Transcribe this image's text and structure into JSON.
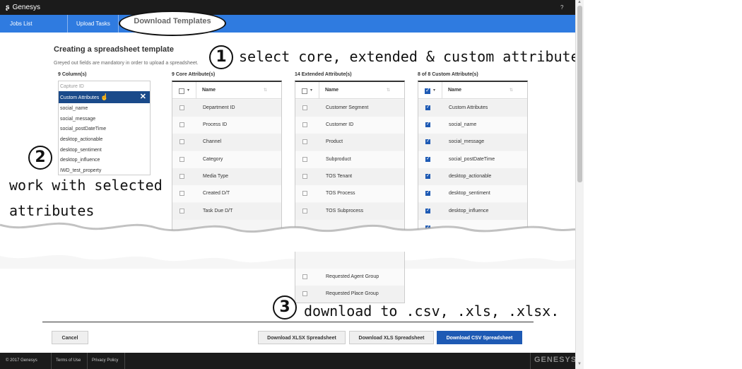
{
  "app": {
    "brand": "Genesys",
    "help": "?"
  },
  "tabs": {
    "jobs_list": "Jobs List",
    "upload_tasks": "Upload Tasks",
    "download_templates": "Download Templates"
  },
  "page": {
    "title": "Creating a spreadsheet template",
    "subtitle": "Greyed out fields are mandatory in order to upload a spreadsheet."
  },
  "callouts": {
    "one_num": "1",
    "one_text": "select core, extended & custom attributes",
    "two_num": "2",
    "two_line1": "work with selected",
    "two_line2": "attributes",
    "three_num": "3",
    "three_text": "download to .csv, .xls, .xlsx."
  },
  "columns": {
    "heading": "9 Column(s)",
    "items": [
      "Capture ID",
      "Custom Attributes",
      "social_name",
      "social_message",
      "social_postDateTime",
      "desktop_actionable",
      "desktop_sentiment",
      "desktop_influence",
      "IWD_test_property"
    ]
  },
  "core": {
    "heading": "9 Core Attribute(s)",
    "name_header": "Name",
    "rows": [
      "Department ID",
      "Process ID",
      "Channel",
      "Category",
      "Media Type",
      "Created D/T",
      "Task Due D/T"
    ]
  },
  "extended": {
    "heading": "14 Extended Attribute(s)",
    "name_header": "Name",
    "rows": [
      "Customer Segment",
      "Customer ID",
      "Product",
      "Subproduct",
      "TOS Tenant",
      "TOS Process",
      "TOS Subprocess"
    ],
    "lower_rows": [
      "Requested Agent Group",
      "Requested Place Group"
    ]
  },
  "custom": {
    "heading": "8 of 8 Custom Attribute(s)",
    "name_header": "Name",
    "rows": [
      "Custom Attributes",
      "social_name",
      "social_message",
      "social_postDateTime",
      "desktop_actionable",
      "desktop_sentiment",
      "desktop_influence"
    ]
  },
  "buttons": {
    "cancel": "Cancel",
    "xlsx": "Download XLSX Spreadsheet",
    "xls": "Download XLS Spreadsheet",
    "csv": "Download CSV Spreadsheet"
  },
  "footer": {
    "copyright": "© 2017 Genesys",
    "terms": "Terms of Use",
    "privacy": "Privacy Policy",
    "logo": "GENESYS"
  },
  "colors": {
    "accent": "#2f7be0",
    "primary_button": "#1e5ab4",
    "selected_row": "#1a4a8a"
  }
}
